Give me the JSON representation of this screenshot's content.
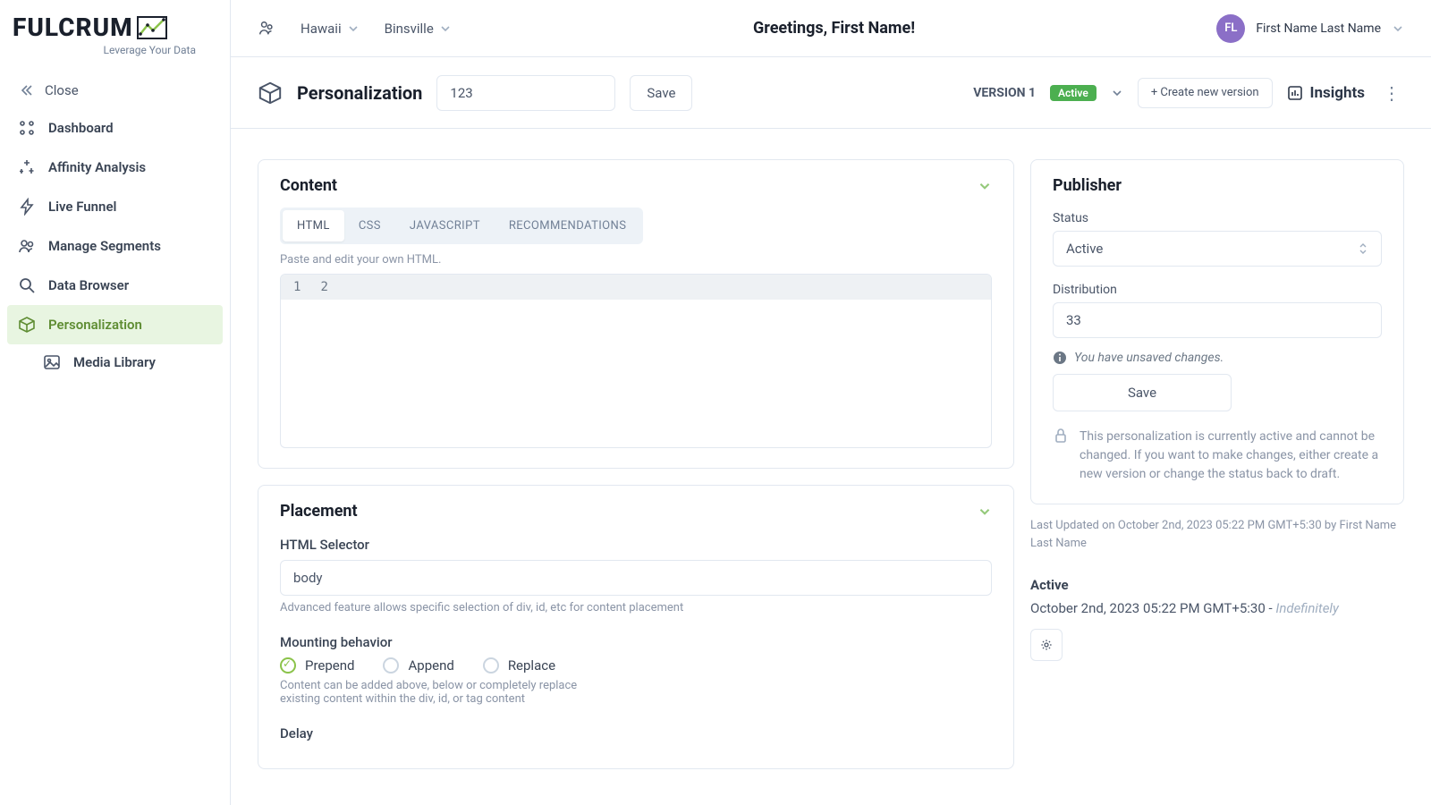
{
  "brand": {
    "name": "FULCRUM",
    "tagline": "Leverage Your Data"
  },
  "topbar": {
    "org_selector": "Hawaii",
    "site_selector": "Binsville",
    "greeting": "Greetings, First Name!",
    "user_initials": "FL",
    "user_name": "First Name Last Name"
  },
  "sidebar": {
    "close": "Close",
    "items": [
      {
        "label": "Dashboard"
      },
      {
        "label": "Affinity Analysis"
      },
      {
        "label": "Live Funnel"
      },
      {
        "label": "Manage Segments"
      },
      {
        "label": "Data Browser"
      },
      {
        "label": "Personalization",
        "active": true
      },
      {
        "label": "Media Library",
        "sub": true
      }
    ]
  },
  "subheader": {
    "title": "Personalization",
    "name_value": "123",
    "save": "Save",
    "version": "VERSION 1",
    "status_badge": "Active",
    "create": "+ Create new version",
    "insights": "Insights"
  },
  "content_card": {
    "title": "Content",
    "tabs": [
      "HTML",
      "CSS",
      "JAVASCRIPT",
      "RECOMMENDATIONS"
    ],
    "active_tab": 0,
    "hint": "Paste and edit your own HTML.",
    "line_numbers": [
      "1",
      "2"
    ]
  },
  "placement_card": {
    "title": "Placement",
    "selector_label": "HTML Selector",
    "selector_value": "body",
    "selector_hint": "Advanced feature allows specific selection of div, id, etc for content placement",
    "mounting_label": "Mounting behavior",
    "mounting_options": [
      "Prepend",
      "Append",
      "Replace"
    ],
    "mounting_selected": 0,
    "mounting_hint": "Content can be added above, below or completely replace existing content within the div, id, or tag content",
    "delay_label": "Delay"
  },
  "publisher_card": {
    "title": "Publisher",
    "status_label": "Status",
    "status_value": "Active",
    "distribution_label": "Distribution",
    "distribution_value": "33",
    "unsaved": "You have unsaved changes.",
    "save": "Save",
    "lock_note": "This personalization is currently active and cannot be changed. If you want to make changes, either create a new version or change the status back to draft."
  },
  "history": {
    "last_updated": "Last Updated on October 2nd, 2023 05:22 PM GMT+5:30 by First Name Last Name",
    "state": "Active",
    "from": "October 2nd, 2023 05:22 PM GMT+5:30 - ",
    "to": "Indefinitely"
  }
}
